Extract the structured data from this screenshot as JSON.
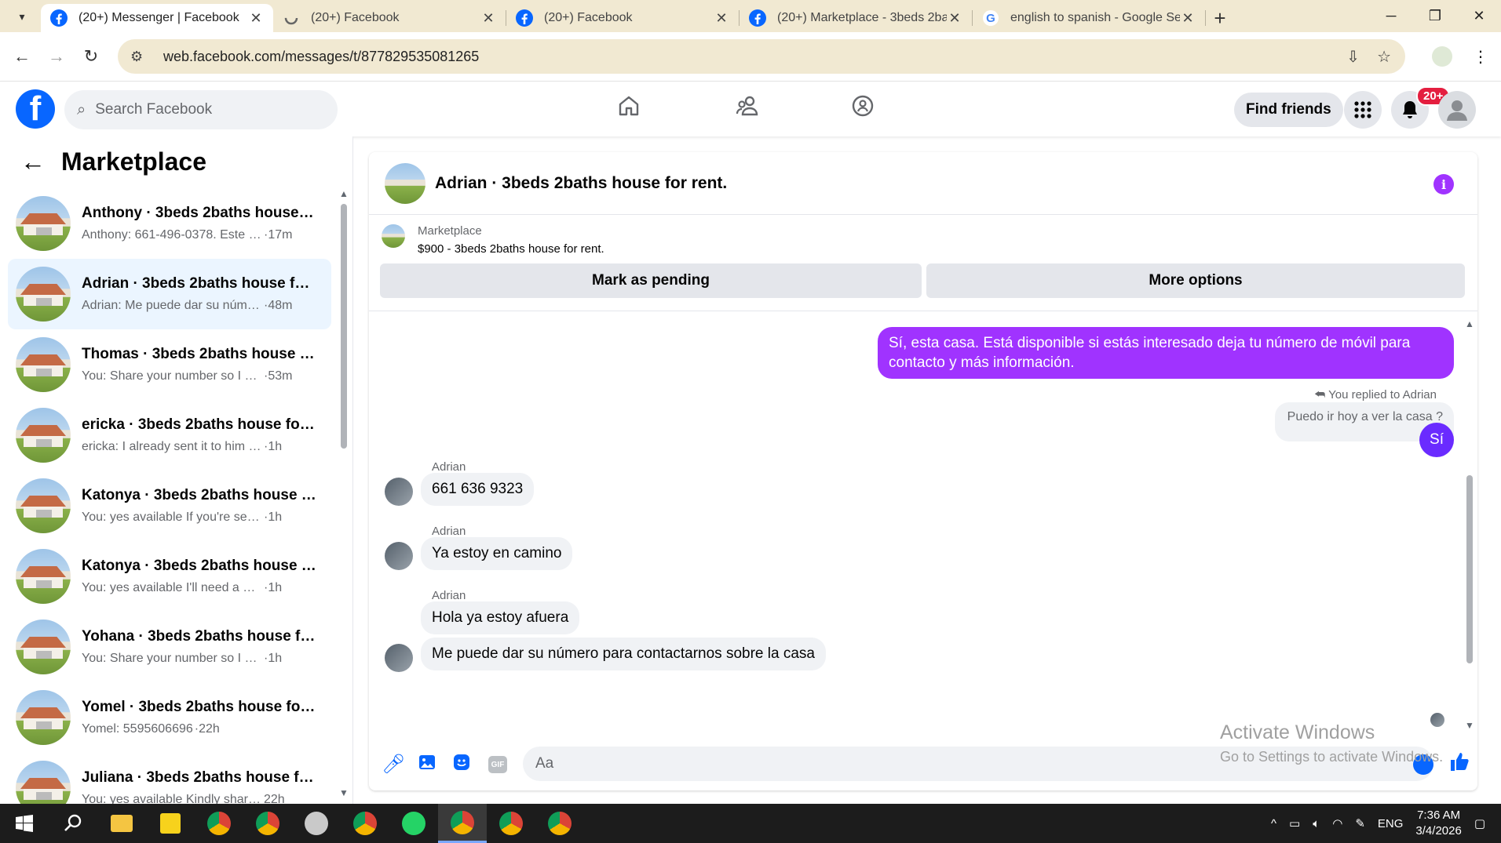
{
  "browser": {
    "tabs": [
      {
        "title": "(20+) Messenger | Facebook",
        "icon": "facebook-icon",
        "active": true
      },
      {
        "title": "(20+) Facebook",
        "icon": "loading-icon",
        "active": false
      },
      {
        "title": "(20+) Facebook",
        "icon": "facebook-icon",
        "active": false
      },
      {
        "title": "(20+) Marketplace - 3beds 2ba",
        "icon": "facebook-icon",
        "active": false
      },
      {
        "title": "english to spanish - Google Sea",
        "icon": "google-icon",
        "active": false
      }
    ],
    "url": "web.facebook.com/messages/t/877829535081265"
  },
  "facebook": {
    "search_placeholder": "Search Facebook",
    "find_friends": "Find friends",
    "notif_badge": "20+"
  },
  "left": {
    "title": "Marketplace",
    "conversations": [
      {
        "name": "Anthony · 3beds 2baths house f...",
        "snippet": "Anthony: 661-496-0378. Este es ...",
        "time": "·17m",
        "selected": false
      },
      {
        "name": "Adrian · 3beds 2baths house for ...",
        "snippet": "Adrian: Me puede dar su número...",
        "time": "·48m",
        "selected": true
      },
      {
        "name": "Thomas · 3beds 2baths house fo...",
        "snippet": "You: Share your number so I can ...",
        "time": "·53m",
        "selected": false
      },
      {
        "name": "ericka · 3beds 2baths house for ...",
        "snippet": "ericka: I already sent it to him so he...",
        "time": "·1h",
        "selected": false
      },
      {
        "name": "Katonya · 3beds 2baths house f...",
        "snippet": "You: yes available If you're seriously...",
        "time": "·1h",
        "selected": false
      },
      {
        "name": "Katonya · 3beds 2baths house f...",
        "snippet": "You: yes available I'll need a numbe...",
        "time": "·1h",
        "selected": false
      },
      {
        "name": "Yohana · 3beds 2baths house fo...",
        "snippet": "You: Share your number so I can g...",
        "time": "·1h",
        "selected": false
      },
      {
        "name": "Yomel · 3beds 2baths house for ...",
        "snippet": "Yomel: 5595606696",
        "time": "·22h",
        "selected": false
      },
      {
        "name": "Juliana · 3beds 2baths house for...",
        "snippet": "You: yes available Kindly share yo...",
        "time": "22h",
        "selected": false
      }
    ]
  },
  "chat": {
    "title": "Adrian · 3beds 2baths house for rent.",
    "marketplace_label": "Marketplace",
    "listing": "$900 - 3beds 2baths house for rent.",
    "mark_pending": "Mark as pending",
    "more_options": "More options",
    "outgoing_1": "Sí, esta casa. Está disponible si estás interesado deja tu número de móvil para contacto y más información.",
    "replied_to": "You replied to Adrian",
    "quoted": "Puedo ir hoy a ver la casa ?",
    "reply": "Sí",
    "incoming": [
      {
        "sender": "Adrian",
        "text": "661 636 9323"
      },
      {
        "sender": "Adrian",
        "text": "Ya estoy en camino"
      },
      {
        "sender": "Adrian",
        "text": "Hola ya estoy afuera"
      },
      {
        "sender": "",
        "text": "Me puede dar su número para contactarnos sobre la casa"
      }
    ],
    "input_placeholder": "Aa"
  },
  "watermark": {
    "line1": "Activate Windows",
    "line2": "Go to Settings to activate Windows."
  },
  "taskbar": {
    "lang": "ENG",
    "time": "7:36 AM",
    "date": "3/4/2026"
  },
  "colors": {
    "fb_blue": "#0866ff",
    "messenger_purple": "#a033ff",
    "selected_row": "#ebf5ff",
    "tabstrip": "#f1e9d2"
  }
}
